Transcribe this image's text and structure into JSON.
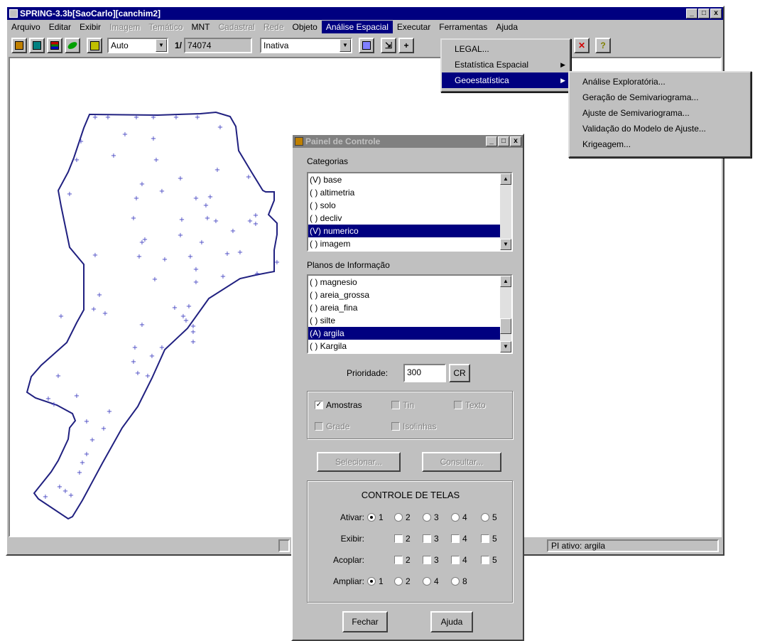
{
  "main_window": {
    "title": "SPRING-3.3b[SaoCarlo][canchim2]",
    "controls": [
      "_",
      "□",
      "x"
    ],
    "menu": [
      {
        "label": "Arquivo",
        "state": "enabled"
      },
      {
        "label": "Editar",
        "state": "enabled"
      },
      {
        "label": "Exibir",
        "state": "enabled"
      },
      {
        "label": "Imagem",
        "state": "disabled"
      },
      {
        "label": "Temático",
        "state": "disabled"
      },
      {
        "label": "MNT",
        "state": "enabled"
      },
      {
        "label": "Cadastral",
        "state": "disabled"
      },
      {
        "label": "Rede",
        "state": "disabled"
      },
      {
        "label": "Objeto",
        "state": "enabled"
      },
      {
        "label": "Análise Espacial",
        "state": "active"
      },
      {
        "label": "Executar",
        "state": "enabled"
      },
      {
        "label": "Ferramentas",
        "state": "enabled"
      },
      {
        "label": "Ajuda",
        "state": "enabled"
      }
    ],
    "toolbar": {
      "scale_mode": "Auto",
      "scale_label": "1/",
      "scale_value": "74074",
      "mode": "Inativa"
    },
    "status": {
      "active_plane": "PI ativo: argila"
    }
  },
  "analise_menu": {
    "items": [
      "LEGAL...",
      "Estatística Espacial",
      "Geoestatística"
    ]
  },
  "geo_submenu": {
    "items": [
      "Análise  Exploratória...",
      "Geração de Semivariograma...",
      "Ajuste de Semivariograma...",
      "Validação do Modelo de Ajuste...",
      "Krigeagem..."
    ]
  },
  "panel": {
    "title": "Painel de Controle",
    "categories_label": "Categorias",
    "categories": [
      {
        "label": "(V) base",
        "selected": false
      },
      {
        "label": "( ) altimetria",
        "selected": false
      },
      {
        "label": "( ) solo",
        "selected": false
      },
      {
        "label": "( ) decliv",
        "selected": false
      },
      {
        "label": "(V) numerico",
        "selected": true
      },
      {
        "label": "( ) imagem",
        "selected": false
      }
    ],
    "planes_label": "Planos de Informação",
    "planes": [
      {
        "label": "( ) magnesio",
        "selected": false
      },
      {
        "label": "( ) areia_grossa",
        "selected": false
      },
      {
        "label": "( ) areia_fina",
        "selected": false
      },
      {
        "label": "( ) silte",
        "selected": false
      },
      {
        "label": "(A) argila",
        "selected": true
      },
      {
        "label": "( ) Kargila",
        "selected": false
      }
    ],
    "priority_label": "Prioridade:",
    "priority_value": "300",
    "cr_label": "CR",
    "opt_amostras": "Amostras",
    "opt_tin": "Tin",
    "opt_texto": "Texto",
    "opt_grade": "Grade",
    "opt_isolinhas": "Isolinhas",
    "btn_selecionar": "Selecionar...",
    "btn_consultar": "Consultar...",
    "telas_title": "CONTROLE DE TELAS",
    "ativar_label": "Ativar:",
    "exibir_label": "Exibir:",
    "acoplar_label": "Acoplar:",
    "ampliar_label": "Ampliar:",
    "nums": [
      "1",
      "2",
      "3",
      "4",
      "5"
    ],
    "zoom": [
      "1",
      "2",
      "4",
      "8"
    ],
    "btn_fechar": "Fechar",
    "btn_ajuda": "Ajuda"
  }
}
